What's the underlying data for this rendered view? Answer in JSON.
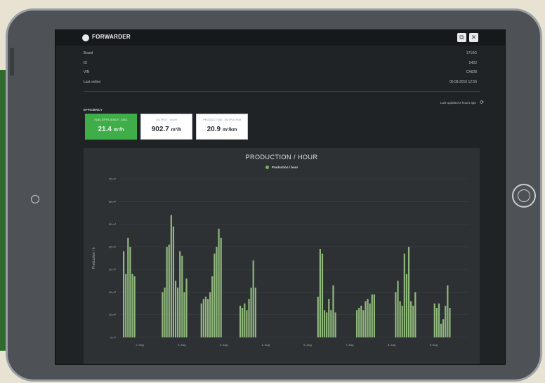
{
  "app": {
    "title": "FORWARDER"
  },
  "window": {
    "restore_icon": "restore-icon",
    "close_icon": "close-icon"
  },
  "info": {
    "rows": [
      {
        "label": "Brand",
        "value": "1710G"
      },
      {
        "label": "ID",
        "value": "5422"
      },
      {
        "label": "VIN",
        "value": "CA628"
      },
      {
        "label": "Last online",
        "value": "05.08.2019 12:56"
      }
    ]
  },
  "status": {
    "updated": "Last updated 2 hours ago"
  },
  "efficiency": {
    "label": "EFFICIENCY",
    "cards": [
      {
        "caption": "FUEL EFFICIENCY - M3/L",
        "value": "21.4",
        "unit": "m³/h",
        "color": "#3fae49"
      },
      {
        "caption": "OUTPUT - M3/H",
        "value": "902.7",
        "unit": "m³/h",
        "color": "#ffffff"
      },
      {
        "caption": "PRODUCTION - OUTPUT/KM",
        "value": "20.9",
        "unit": "m³/km",
        "color": "#ffffff"
      }
    ]
  },
  "chart_data": {
    "type": "bar",
    "title": "PRODUCTION / HOUR",
    "ylabel": "Production / h",
    "ylim": [
      0,
      70
    ],
    "yticks": [
      "0 m³",
      "10 m³",
      "20 m³",
      "30 m³",
      "40 m³",
      "50 m³",
      "60 m³",
      "70 m³"
    ],
    "categories": [
      "2. Aug",
      "3. Aug",
      "4. Aug",
      "5. Aug",
      "6. Aug",
      "7. Aug",
      "8. Aug",
      "9. Aug"
    ],
    "series": [
      {
        "name": "Production / hour",
        "color": "#8fb87b",
        "groups": [
          [
            38,
            28,
            44,
            40,
            28,
            27
          ],
          [
            20,
            22,
            40,
            41,
            54,
            49,
            25,
            22,
            38,
            36,
            20,
            26
          ],
          [
            15,
            17,
            18,
            17,
            20,
            27,
            37,
            40,
            48,
            44
          ],
          [
            14,
            13,
            15,
            12,
            17,
            22,
            34,
            22
          ],
          [],
          [
            18,
            39,
            37,
            12,
            11,
            17,
            12,
            23,
            11
          ],
          [
            12,
            13,
            14,
            12,
            16,
            17,
            15,
            19,
            19
          ],
          [
            20,
            25,
            16,
            14,
            37,
            28,
            40,
            16,
            14,
            20
          ],
          [
            15,
            13,
            15,
            6,
            8,
            14,
            23,
            13
          ]
        ]
      }
    ]
  }
}
